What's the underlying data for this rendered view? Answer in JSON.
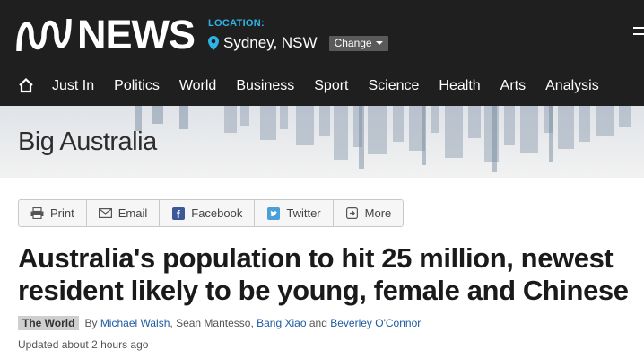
{
  "brand": {
    "name": "NEWS"
  },
  "location": {
    "label": "LOCATION:",
    "city": "Sydney, NSW",
    "change_label": "Change"
  },
  "nav": {
    "items": [
      "Just In",
      "Politics",
      "World",
      "Business",
      "Sport",
      "Science",
      "Health",
      "Arts",
      "Analysis"
    ]
  },
  "section": {
    "title": "Big Australia"
  },
  "share": {
    "print": "Print",
    "email": "Email",
    "facebook": "Facebook",
    "twitter": "Twitter",
    "more": "More"
  },
  "article": {
    "headline": "Australia's population to hit 25 million, newest resident likely to be young, female and Chinese",
    "topic": "The World",
    "by": "By",
    "authors": [
      "Michael Walsh",
      "Sean Mantesso",
      "Bang Xiao",
      "Beverley O'Connor"
    ],
    "and": "and",
    "updated": "Updated about 2 hours ago"
  },
  "colors": {
    "header_bg": "#1f1f1f",
    "location_accent": "#2fb3e6",
    "link": "#1d5aa0"
  }
}
